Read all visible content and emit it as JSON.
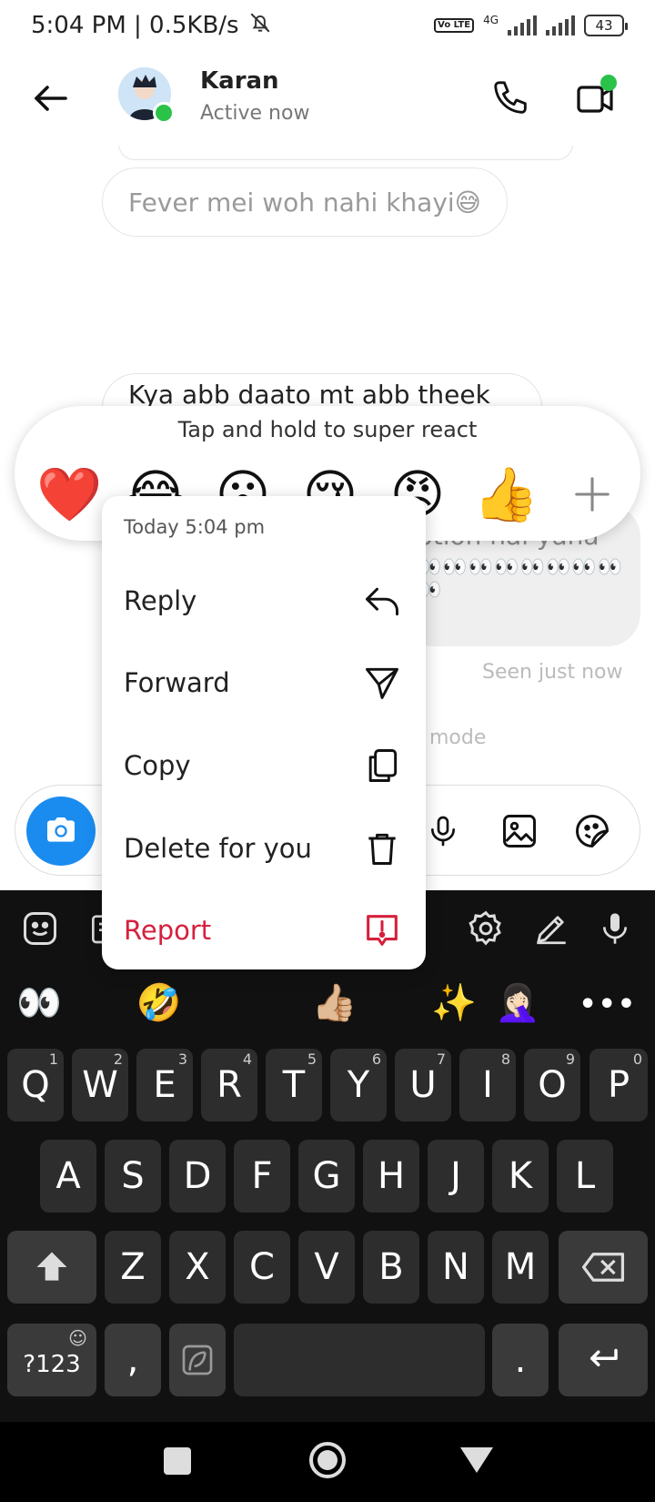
{
  "status_bar": {
    "time": "5:04 PM | 0.5KB/s",
    "network": "4G",
    "volte": "Vo LTE",
    "battery": "43"
  },
  "header": {
    "name": "Karan",
    "status": "Active now"
  },
  "messages": {
    "fever": "Fever mei woh nahi khayi😅",
    "kya_line1": "Kya abb daato mt abb theek hu",
    "kya_line2": "🤣",
    "right_visible": "ption hai yaha",
    "right_eyes": "👀👀👀👀👀👀👀👀👀",
    "seen": "Seen just now",
    "mode_fragment": "mode"
  },
  "reaction_bar": {
    "hint": "Tap and hold to super react",
    "reactions": [
      "❤️",
      "😂",
      "😮",
      "😢",
      "😡",
      "👍"
    ]
  },
  "context_menu": {
    "timestamp": "Today 5:04 pm",
    "reply": "Reply",
    "forward": "Forward",
    "copy": "Copy",
    "delete": "Delete for you",
    "report": "Report"
  },
  "keyboard": {
    "emoji_row": [
      "👀",
      "😅",
      "🤣",
      "😁",
      "😛",
      "👍🏼",
      "🙃",
      "✨",
      "🤦🏻‍♀️",
      "😑"
    ],
    "row1": [
      [
        "Q",
        "1"
      ],
      [
        "W",
        "2"
      ],
      [
        "E",
        "3"
      ],
      [
        "R",
        "4"
      ],
      [
        "T",
        "5"
      ],
      [
        "Y",
        "6"
      ],
      [
        "U",
        "7"
      ],
      [
        "I",
        "8"
      ],
      [
        "O",
        "9"
      ],
      [
        "P",
        "0"
      ]
    ],
    "row2": [
      "A",
      "S",
      "D",
      "F",
      "G",
      "H",
      "J",
      "K",
      "L"
    ],
    "row3": [
      "Z",
      "X",
      "C",
      "V",
      "B",
      "N",
      "M"
    ],
    "symbols_key": "?123",
    "comma_key": ",",
    "period_key": "."
  },
  "colors": {
    "accent_blue": "#1a8cf0",
    "online_green": "#2bc24a",
    "report_red": "#d4213d",
    "keyboard_bg": "#111111"
  }
}
